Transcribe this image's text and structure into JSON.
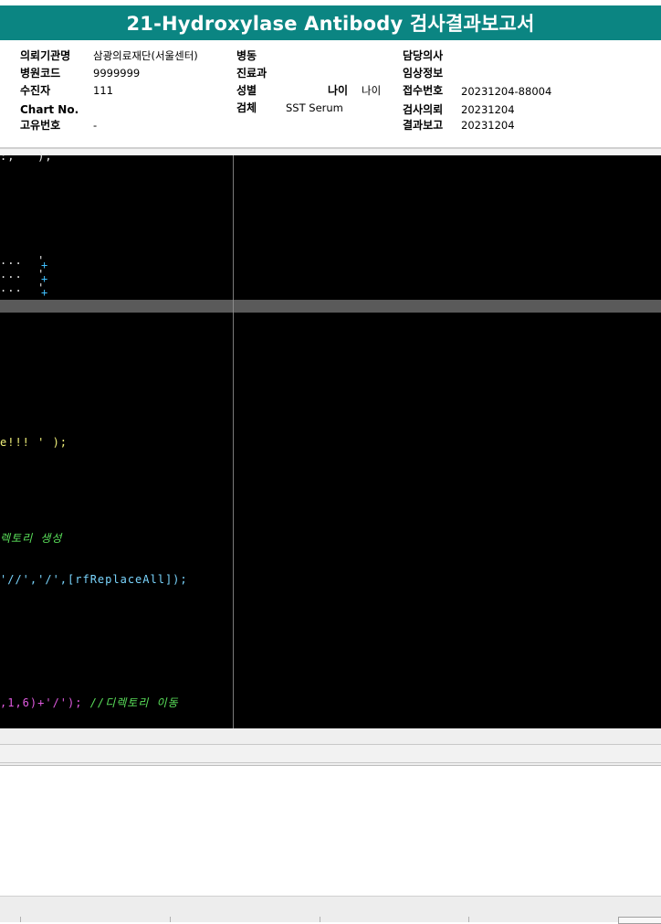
{
  "report": {
    "title": "21-Hydroxylase Antibody 검사결과보고서"
  },
  "info": {
    "col1": [
      {
        "label": "의뢰기관명",
        "value": "삼광의료재단(서울센터)"
      },
      {
        "label": "병원코드",
        "value": "9999999"
      },
      {
        "label": "수진자",
        "value": "111"
      },
      {
        "label": "Chart No.",
        "value": ""
      },
      {
        "label": "고유번호",
        "value": "-"
      }
    ],
    "col2": [
      {
        "label": "병동",
        "value": ""
      },
      {
        "label": "진료과",
        "value": ""
      },
      {
        "label": "성별",
        "value": ""
      },
      {
        "label": "검체",
        "value": "SST Serum"
      }
    ],
    "age": {
      "label": "나이",
      "value": "나이"
    },
    "col3": [
      {
        "label": "담당의사",
        "value": ""
      },
      {
        "label": "임상정보",
        "value": ""
      },
      {
        "label": "접수번호",
        "value": "20231204-88004"
      },
      {
        "label": "검사의뢰",
        "value": "20231204"
      },
      {
        "label": "결과보고",
        "value": "20231204"
      }
    ]
  },
  "code": {
    "line_top": ":;   );",
    "dots": [
      "...  '",
      "...  '",
      "...  '"
    ],
    "plus": "+",
    "line_msg": "e!!! ' );",
    "comment_create": "렉토리 생성",
    "line_replace": "'//','/',[rfReplaceAll]);",
    "line_last_a": ",1,6)+'/'); ",
    "line_last_b": "//디렉토리 이동"
  },
  "colors": {
    "title_bar": "#0b8582",
    "editor_bg": "#000000",
    "code_yellow": "#f2f27a",
    "code_cyan": "#7ad6ff",
    "code_green": "#5ae05a",
    "code_magenta": "#e05ae0"
  }
}
